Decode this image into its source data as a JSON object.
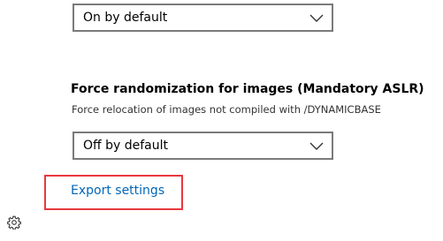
{
  "top_dropdown": {
    "selected": "On by default",
    "icon": "chevron-down-icon"
  },
  "mandatory_aslr": {
    "title": "Force randomization for images (Mandatory ASLR)",
    "description": "Force relocation of images not compiled with /DYNAMICBASE",
    "selected": "Off by default",
    "icon": "chevron-down-icon"
  },
  "export": {
    "label": "Export settings",
    "link_color": "#0067b8",
    "highlight_color": "#e8383d"
  },
  "footer": {
    "settings_icon": "gear-icon"
  }
}
